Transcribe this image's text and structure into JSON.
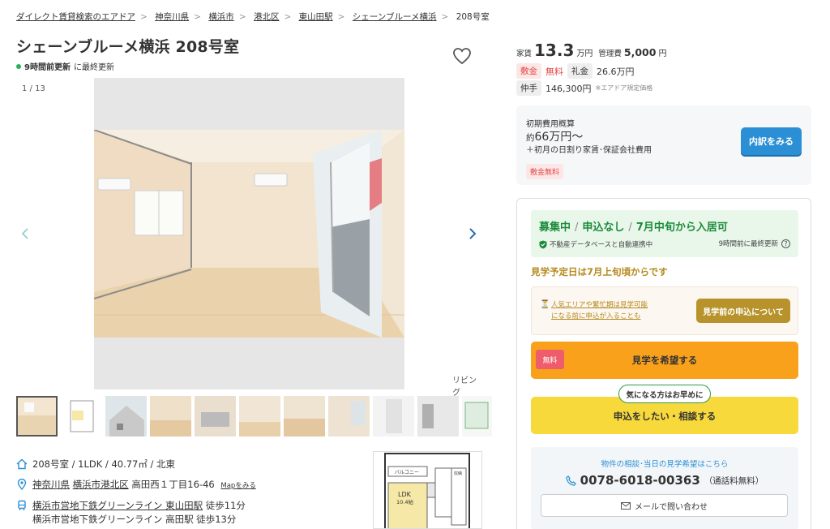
{
  "breadcrumb": [
    {
      "label": "ダイレクト賃貸検索のエアドア",
      "link": true
    },
    {
      "label": "神奈川県",
      "link": true
    },
    {
      "label": "横浜市",
      "link": true
    },
    {
      "label": "港北区",
      "link": true
    },
    {
      "label": "東山田駅",
      "link": true
    },
    {
      "label": "シェーンブルーメ横浜",
      "link": true
    },
    {
      "label": "208号室",
      "link": false
    }
  ],
  "title": "シェーンブルーメ横浜 208号室",
  "updated": {
    "bold": "9時間前更新",
    "rest": "に最終更新"
  },
  "gallery": {
    "counter": "1 / 13",
    "caption": "リビング"
  },
  "info": {
    "room": "208号室 / 1LDK / 40.77㎡ / 北東",
    "address_pref": "神奈川県",
    "address_city": "横浜市港北区",
    "address_rest": "高田西１丁目16-46",
    "map_link": "Mapをみる",
    "line1_station": "横浜市営地下鉄グリーンライン 東山田駅",
    "line1_walk": "徒歩11分",
    "line2": "横浜市営地下鉄グリーンライン 高田駅 徒歩13分"
  },
  "floorplan": {
    "balcony": "バルコニー",
    "ldk": "LDK",
    "ldk_size": "10.4帖",
    "closet": "収納"
  },
  "price": {
    "rent_label": "家賃",
    "rent_value": "13.3",
    "rent_unit": "万円",
    "mgmt_label": "管理費",
    "mgmt_value": "5,000",
    "mgmt_unit": "円"
  },
  "fees": {
    "deposit_label": "敷金",
    "deposit_value": "無料",
    "key_label": "礼金",
    "key_value": "26.6万円",
    "agent_label": "仲手",
    "agent_value": "146,300円",
    "agent_note": "※エアドア規定価格"
  },
  "initial": {
    "title": "初期費用概算",
    "approx": "約",
    "amount": "66万円〜",
    "note": "＋初月の日割り家賃･保証会社費用",
    "tag": "敷金無料",
    "button": "内訳をみる"
  },
  "status": {
    "recruiting": "募集中",
    "no_apply": "申込なし",
    "move_in": "7月中旬から入居可",
    "auto_link": "不動産データベースと自動連携中",
    "last_update": "9時間前に最終更新"
  },
  "visit_date": "見学予定日は7月上旬頃からです",
  "warning": {
    "line1": "人気エリアや繁忙期は見学可能",
    "line2": "になる前に申込が入ることも",
    "button": "見学前の申込について"
  },
  "visit": {
    "badge": "無料",
    "label": "見学を希望する"
  },
  "apply": {
    "bubble": "気になる方はお早めに",
    "label": "申込をしたい・相談する"
  },
  "contact": {
    "title": "物件の相談･当日の見学希望はこちら",
    "phone": "0078-6018-00363",
    "phone_note": "（通話料無料）",
    "mail": "メールで問い合わせ"
  },
  "colors": {
    "green": "#1b8c3b",
    "blue": "#2b8fd6",
    "orange": "#f9a11b",
    "yellow": "#f8d93b",
    "gold": "#b8932b",
    "red": "#e34b4b"
  },
  "icons": [
    "heart-icon",
    "chevron-left-icon",
    "chevron-right-icon",
    "home-icon",
    "pin-icon",
    "train-icon",
    "shield-check-icon",
    "question-icon",
    "hourglass-icon",
    "phone-icon",
    "mail-icon"
  ]
}
